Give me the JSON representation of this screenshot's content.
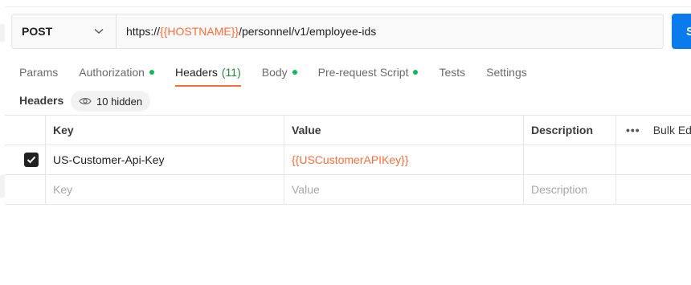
{
  "request": {
    "method": "POST",
    "url_prefix": "https://",
    "url_variable": "{{HOSTNAME}}",
    "url_suffix": "/personnel/v1/employee-ids",
    "send_label": "S"
  },
  "tabs": [
    {
      "label": "Params"
    },
    {
      "label": "Authorization"
    },
    {
      "label": "Headers",
      "count": "(11)"
    },
    {
      "label": "Body"
    },
    {
      "label": "Pre-request Script"
    },
    {
      "label": "Tests"
    },
    {
      "label": "Settings"
    }
  ],
  "headers_section": {
    "label": "Headers",
    "hidden_label": "10 hidden"
  },
  "table": {
    "columns": {
      "key": "Key",
      "value": "Value",
      "description": "Description",
      "bulk_edit": "Bulk Edi"
    },
    "rows": [
      {
        "key": "US-Customer-Api-Key",
        "value": "{{USCustomerAPIKey}}",
        "description": ""
      }
    ],
    "placeholder": {
      "key": "Key",
      "value": "Value",
      "description": "Description"
    }
  },
  "colors": {
    "accent": "#ff6c37",
    "send": "#097bed",
    "dot": "#0cbb52"
  }
}
